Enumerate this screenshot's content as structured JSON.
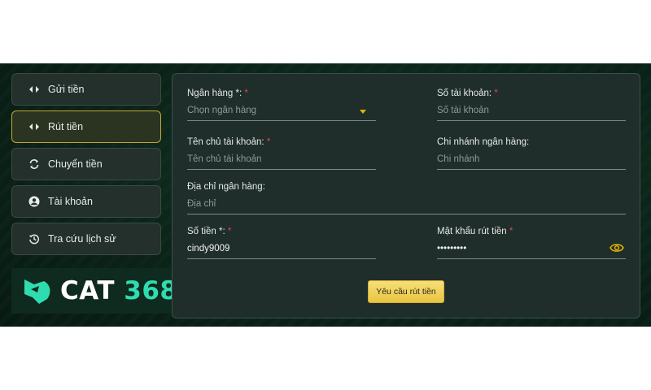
{
  "sidebar": {
    "items": [
      {
        "label": "Gửi tiền",
        "icon": "transfer-arrows-icon"
      },
      {
        "label": "Rút tiền",
        "icon": "transfer-arrows-icon",
        "active": true
      },
      {
        "label": "Chuyển tiền",
        "icon": "sync-icon"
      },
      {
        "label": "Tài khoản",
        "icon": "user-icon"
      },
      {
        "label": "Tra cứu lịch sử",
        "icon": "history-icon"
      }
    ]
  },
  "logo": {
    "text": "CAT",
    "number": "368"
  },
  "form": {
    "bank": {
      "label": "Ngân hàng *:",
      "required": "*",
      "placeholder": "Chọn ngân hàng"
    },
    "account_number": {
      "label": "Số tài khoản:",
      "required": "*",
      "placeholder": "Số tài khoản"
    },
    "account_holder": {
      "label": "Tên chủ tài khoản:",
      "required": "*",
      "placeholder": "Tên chủ tài khoản"
    },
    "branch": {
      "label": "Chi nhánh ngân hàng:",
      "placeholder": "Chi nhánh"
    },
    "bank_address": {
      "label": "Địa chỉ ngân hàng:",
      "placeholder": "Địa chỉ"
    },
    "amount": {
      "label": "Số tiền *:",
      "required": "*",
      "value": "cindy9009"
    },
    "withdraw_password": {
      "label": "Mật khẩu rút tiền",
      "required": "*",
      "value": "•••••••••"
    },
    "submit_label": "Yêu cầu rút tiền"
  },
  "colors": {
    "accent": "#e2b400",
    "brand": "#2fdcb0",
    "required": "#e04848"
  }
}
